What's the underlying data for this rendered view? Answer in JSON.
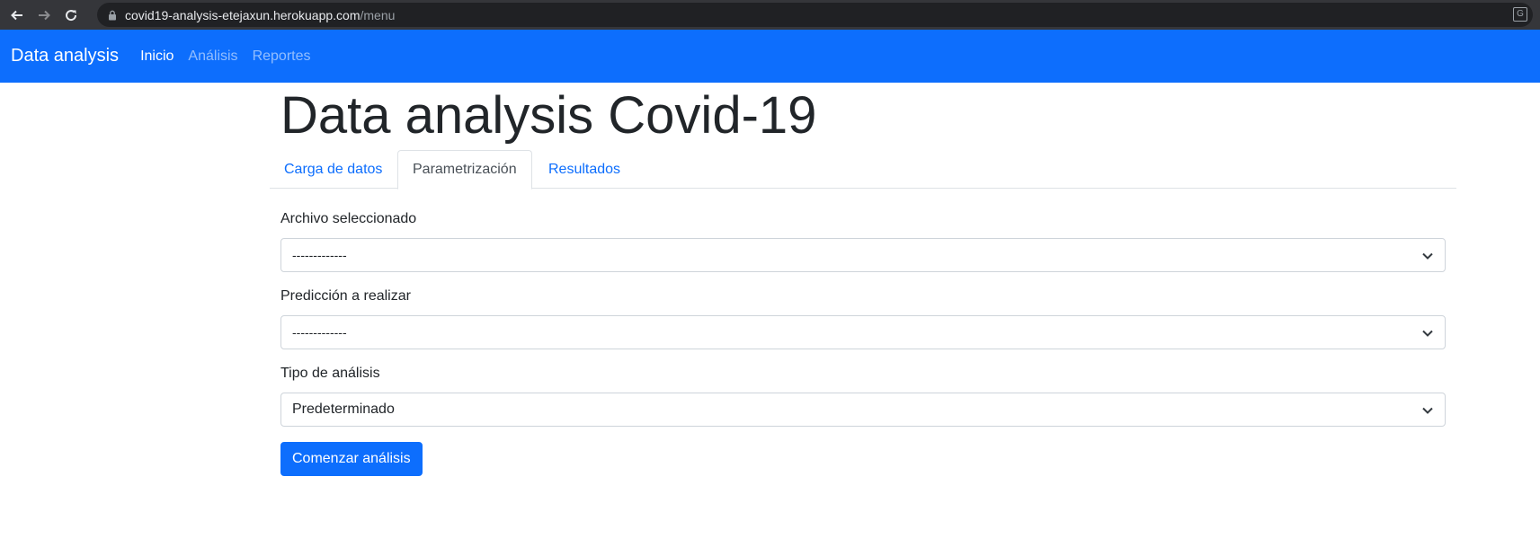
{
  "browser": {
    "url_host": "covid19-analysis-etejaxun.herokuapp.com",
    "url_path": "/menu",
    "translate_glyph": "G"
  },
  "navbar": {
    "brand": "Data analysis",
    "links": [
      {
        "label": "Inicio",
        "active": true
      },
      {
        "label": "Análisis",
        "active": false
      },
      {
        "label": "Reportes",
        "active": false
      }
    ]
  },
  "main": {
    "title": "Data analysis Covid-19",
    "tabs": [
      {
        "label": "Carga de datos",
        "active": false
      },
      {
        "label": "Parametrización",
        "active": true
      },
      {
        "label": "Resultados",
        "active": false
      }
    ],
    "form": {
      "archivo_label": "Archivo seleccionado",
      "archivo_value": "-------------",
      "prediccion_label": "Predicción a realizar",
      "prediccion_value": "-------------",
      "tipo_label": "Tipo de análisis",
      "tipo_value": "Predeterminado",
      "submit_label": "Comenzar análisis"
    }
  },
  "colors": {
    "primary": "#0d6efd",
    "chrome_bar": "#35363a",
    "url_box": "#202124"
  }
}
